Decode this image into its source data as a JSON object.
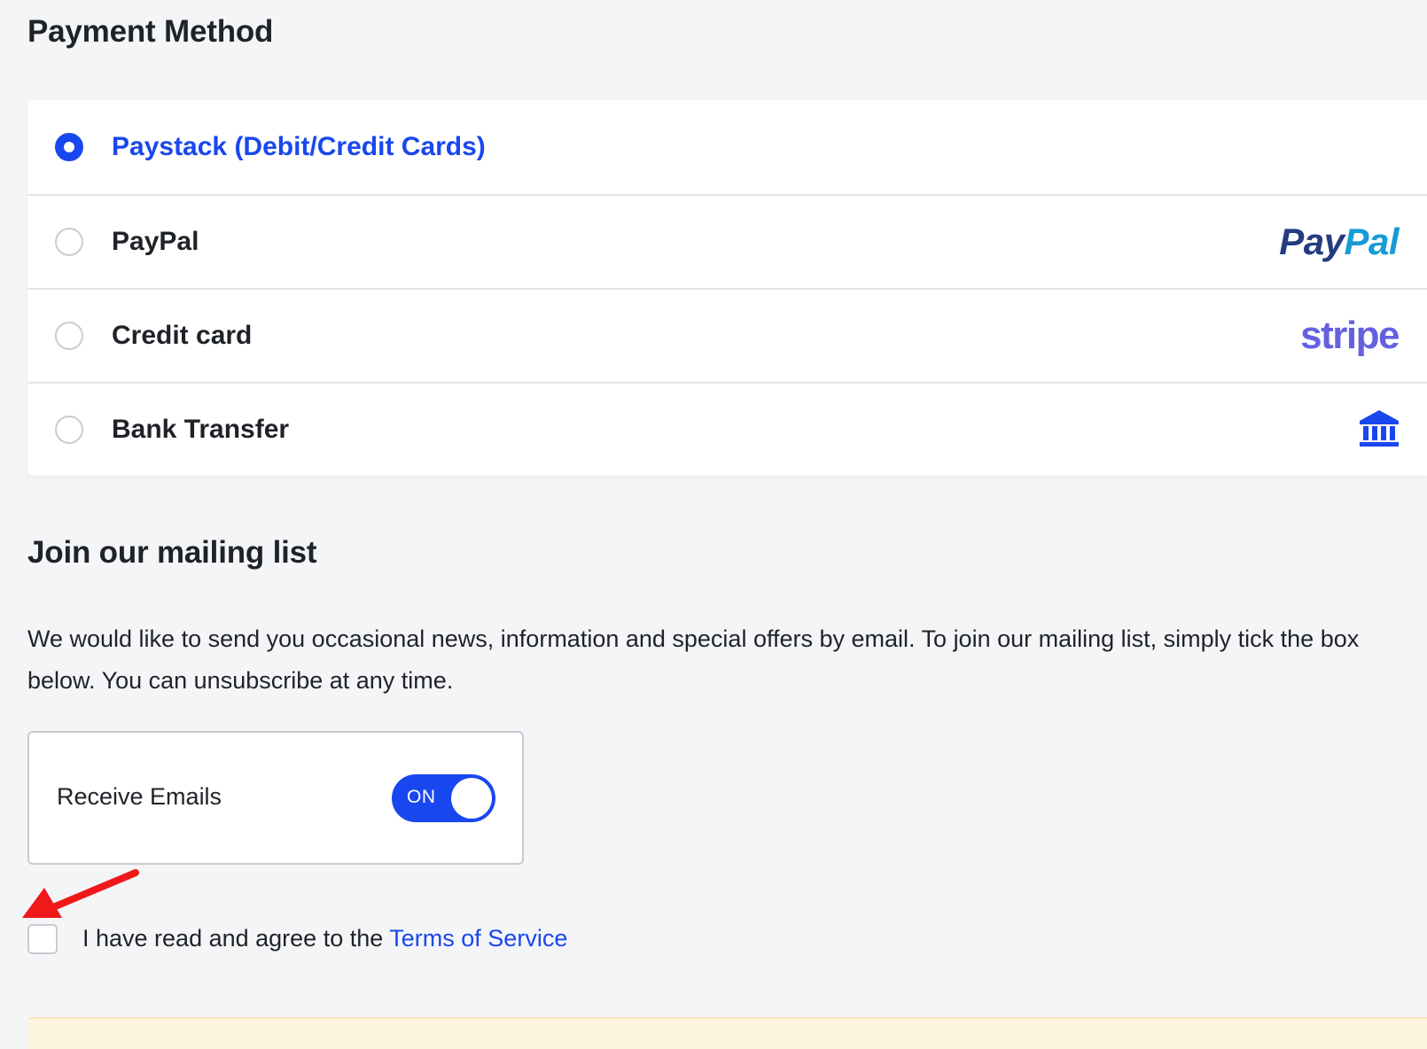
{
  "payment": {
    "title": "Payment Method",
    "selected": "paystack",
    "methods": [
      {
        "id": "paystack",
        "label": "Paystack (Debit/Credit Cards)",
        "logo": ""
      },
      {
        "id": "paypal",
        "label": "PayPal",
        "logo": "paypal-logo"
      },
      {
        "id": "credit",
        "label": "Credit card",
        "logo": "stripe-logo"
      },
      {
        "id": "bank",
        "label": "Bank Transfer",
        "logo": "bank-icon"
      }
    ],
    "paypal_logo": {
      "part1": "Pay",
      "part2": "Pal"
    },
    "stripe_logo": "stripe"
  },
  "mailing": {
    "title": "Join our mailing list",
    "description": "We would like to send you occasional news, information and special offers by email. To join our mailing list, simply tick the box below. You can unsubscribe at any time.",
    "receive_label": "Receive Emails",
    "toggle_state": "ON"
  },
  "terms": {
    "checked": false,
    "prefix": "I have read and agree to the ",
    "link_text": "Terms of Service"
  },
  "colors": {
    "accent": "#1947ef",
    "paypal_dark": "#253b80",
    "paypal_light": "#179bd7",
    "stripe": "#6461e0",
    "annotation_arrow": "#f01818"
  }
}
